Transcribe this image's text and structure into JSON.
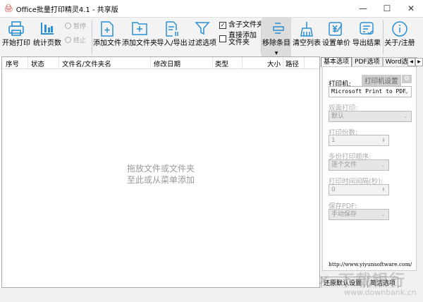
{
  "window": {
    "title": "Office批量打印精灵4.1 - 共享版",
    "minimize": "—",
    "maximize": "☐",
    "close": "✕"
  },
  "toolbar": {
    "start_print": "开始打印",
    "count_pages": "统计页数",
    "pause": "暂停",
    "stop": "终止",
    "add_file": "添加文件",
    "add_folder": "添加文件夹",
    "import_export": "导入/导出",
    "filter": "过滤选项",
    "include_subfolders": "含子文件夹",
    "include_subfolders_checked": true,
    "direct_add_folder": "直接添加文件夹",
    "direct_add_checked": false,
    "remove_item": "移除条目",
    "clear_list": "清空列表",
    "set_price": "设置单价",
    "export_result": "导出结果",
    "about": "关于/注册",
    "accent": "#2a8fd4"
  },
  "table": {
    "columns": [
      "序号",
      "状态",
      "文件名/文件夹名",
      "修改日期",
      "类型",
      "大小",
      "路径"
    ],
    "empty_line1": "拖放文件或文件夹",
    "empty_line2": "至此或从菜单添加"
  },
  "panel": {
    "tabs": [
      "基本选项",
      "PDF选项",
      "Word选项"
    ],
    "printer_label": "打印机:",
    "printer_settings": "打印机设置",
    "printer_value": "Microsoft Print to PDF",
    "duplex_label": "双面打印:",
    "duplex_value": "默认",
    "copies_label": "打印份数:",
    "copies_value": "1",
    "order_label": "多份打印顺序:",
    "order_value": "逐个文件",
    "interval_label": "打印时间间隔(秒):",
    "interval_value": "0",
    "save_pdf_label": "保存PDF:",
    "save_pdf_value": "手动保存",
    "url": "http://www.yiyunsoftware.com/",
    "restore_defaults": "还原默认设置",
    "simple_options": "简洁选项"
  },
  "watermark": {
    "text": "下载银行",
    "url": "www.downbank.cn"
  }
}
